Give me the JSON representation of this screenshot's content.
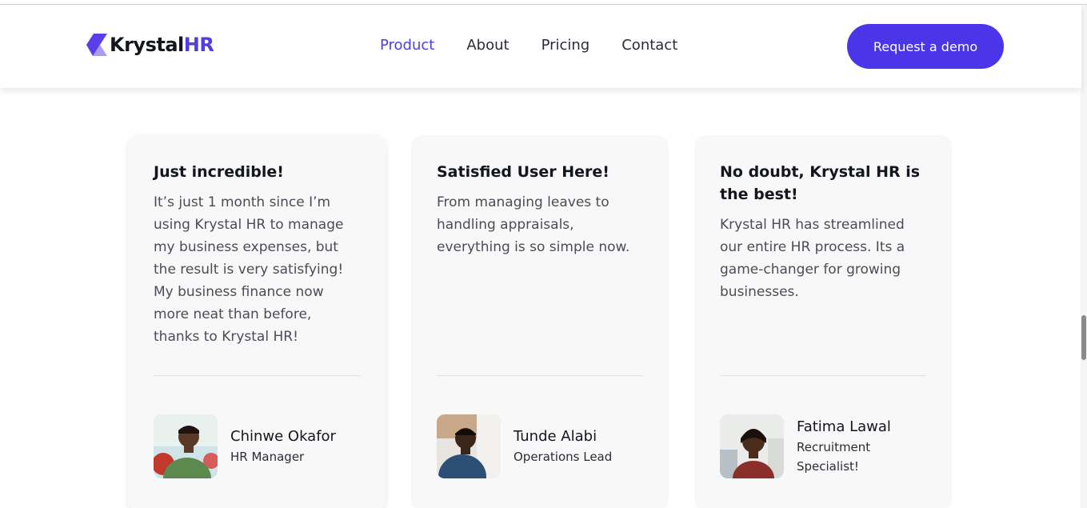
{
  "brand": {
    "name_part1": "Krystal",
    "name_part2": "HR",
    "accent": "#4f3ce3"
  },
  "nav": {
    "items": [
      {
        "label": "Product",
        "active": true
      },
      {
        "label": "About",
        "active": false
      },
      {
        "label": "Pricing",
        "active": false
      },
      {
        "label": "Contact",
        "active": false
      }
    ],
    "cta_label": "Request a demo"
  },
  "testimonials": [
    {
      "title": "Just incredible!",
      "body": "It’s just 1 month since I’m using Krystal HR to manage my business expenses, but the result is very satisfying! My business finance now more neat than before, thanks to Krystal HR!",
      "name": "Chinwe Okafor",
      "role": "HR Manager"
    },
    {
      "title": "Satisfied User Here!",
      "body": "From managing leaves to handling appraisals, everything is so simple now.",
      "name": "Tunde Alabi",
      "role": "Operations Lead"
    },
    {
      "title": "No doubt, Krystal HR is the best!",
      "body": "Krystal HR has streamlined our entire HR process. Its a game-changer for growing businesses.",
      "name": "Fatima Lawal",
      "role": "Recruitment Specialist!"
    }
  ]
}
